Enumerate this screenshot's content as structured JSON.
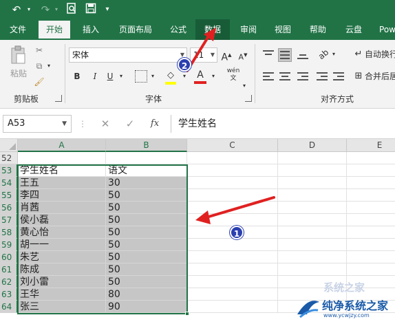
{
  "quick_access": [
    "undo-icon",
    "redo-icon",
    "print-preview-icon",
    "save-icon"
  ],
  "tabs": [
    "文件",
    "开始",
    "插入",
    "页面布局",
    "公式",
    "数据",
    "审阅",
    "视图",
    "帮助",
    "云盘",
    "Pow"
  ],
  "ribbon": {
    "clipboard": {
      "paste": "粘贴",
      "label": "剪贴板"
    },
    "font": {
      "name": "宋体",
      "size": "11",
      "bold": "B",
      "italic": "I",
      "underline": "U",
      "wen": "wén",
      "label": "字体"
    },
    "alignment": {
      "wrap": "自动换行",
      "merge": "合并后居",
      "label": "对齐方式"
    }
  },
  "formula_bar": {
    "name_box": "A53",
    "fx": "fx",
    "content": "学生姓名"
  },
  "columns": [
    "A",
    "B",
    "C",
    "D",
    "E"
  ],
  "rows": [
    {
      "num": "52",
      "a": "",
      "b": ""
    },
    {
      "num": "53",
      "a": "学生姓名",
      "b": "语文"
    },
    {
      "num": "54",
      "a": "王五",
      "b": "30"
    },
    {
      "num": "55",
      "a": "李四",
      "b": "50"
    },
    {
      "num": "56",
      "a": "肖茜",
      "b": "50"
    },
    {
      "num": "57",
      "a": "侯小磊",
      "b": "50"
    },
    {
      "num": "58",
      "a": "黄心怡",
      "b": "50"
    },
    {
      "num": "59",
      "a": "胡一一",
      "b": "50"
    },
    {
      "num": "60",
      "a": "朱艺",
      "b": "50"
    },
    {
      "num": "61",
      "a": "陈成",
      "b": "50"
    },
    {
      "num": "62",
      "a": "刘小雷",
      "b": "50"
    },
    {
      "num": "63",
      "a": "王华",
      "b": "80"
    },
    {
      "num": "64",
      "a": "张三",
      "b": "90"
    }
  ],
  "annotations": {
    "badge1": "1",
    "badge2": "2"
  },
  "watermark": {
    "title": "纯净系统之家",
    "url": "www.ycwjzy.com",
    "bg_text": "系统之家"
  },
  "colors": {
    "excel_green": "#217346",
    "arrow_red": "#e02020",
    "badge_blue": "#2b3fb0"
  }
}
